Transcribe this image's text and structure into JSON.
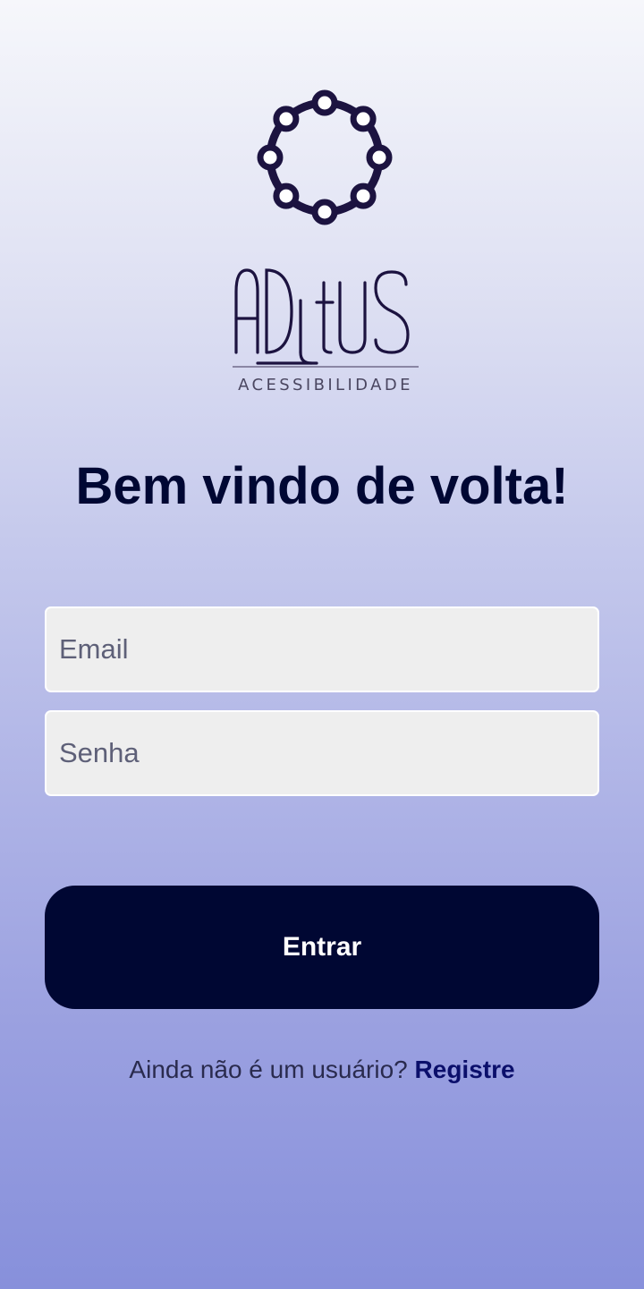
{
  "brand": {
    "logo_wordmark": "ADItUS",
    "logo_subtitle": "ACESSIBILIDADE",
    "logo_color": "#1c1340"
  },
  "header": {
    "title": "Bem vindo de volta!"
  },
  "form": {
    "email_placeholder": "Email",
    "email_value": "",
    "password_placeholder": "Senha",
    "password_value": "",
    "submit_label": "Entrar"
  },
  "footer": {
    "prompt": "Ainda não é um usuário?",
    "register_link": "Registre"
  },
  "colors": {
    "primary": "#000733",
    "link": "#0b0f6b",
    "input_bg": "#eeeeee"
  }
}
